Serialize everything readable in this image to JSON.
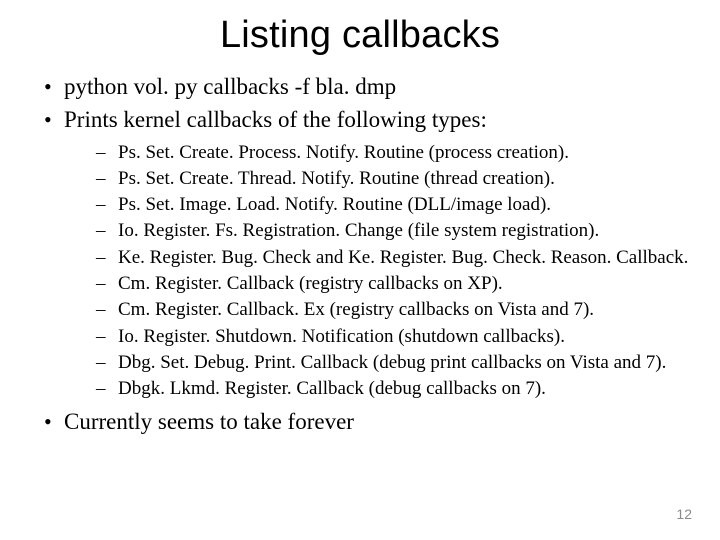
{
  "title": "Listing callbacks",
  "bullets": {
    "b0": "python vol. py callbacks -f bla. dmp",
    "b1": "Prints kernel callbacks of the following types:",
    "b2": "Currently seems to take forever"
  },
  "sub": {
    "s0": "Ps. Set. Create. Process. Notify. Routine (process creation).",
    "s1": "Ps. Set. Create. Thread. Notify. Routine (thread creation).",
    "s2": "Ps. Set. Image. Load. Notify. Routine (DLL/image load).",
    "s3": "Io. Register. Fs. Registration. Change (file system registration).",
    "s4": "Ke. Register. Bug. Check and Ke. Register. Bug. Check. Reason. Callback.",
    "s5": "Cm. Register. Callback (registry callbacks on XP).",
    "s6": "Cm. Register. Callback. Ex (registry callbacks on Vista and 7).",
    "s7": "Io. Register. Shutdown. Notification (shutdown callbacks).",
    "s8": "Dbg. Set. Debug. Print. Callback (debug print callbacks on Vista and 7).",
    "s9": "Dbgk. Lkmd. Register. Callback (debug callbacks on 7)."
  },
  "page_number": "12"
}
